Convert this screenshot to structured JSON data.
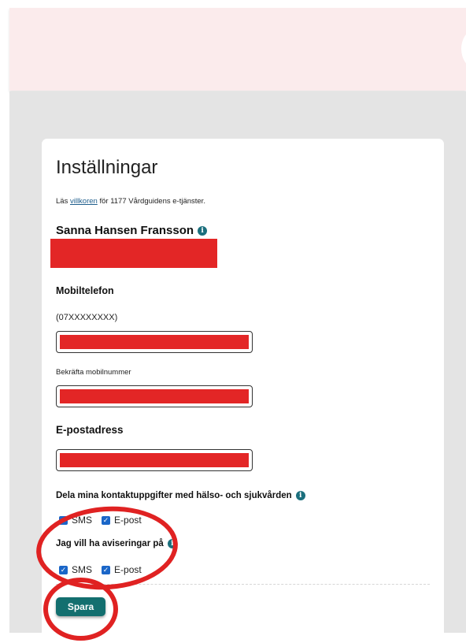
{
  "page": {
    "title": "Inställningar",
    "terms": {
      "prefix": "Läs ",
      "link": "villkoren",
      "suffix": " för 1177 Vårdguidens e-tjänster."
    },
    "user_name": "Sanna Hansen Fransson",
    "info_glyph": "i"
  },
  "form": {
    "mobile_label": "Mobiltelefon",
    "mobile_format_hint": "(07XXXXXXXX)",
    "confirm_mobile_label": "Bekräfta mobilnummer",
    "email_label": "E-postadress",
    "share_label": "Dela mina kontaktuppgifter med hälso- och sjukvården",
    "notify_label": "Jag vill ha aviseringar på",
    "sms_label": "SMS",
    "email_option_label": "E-post",
    "share_sms_checked": true,
    "share_email_checked": true,
    "notify_sms_checked": true,
    "notify_email_checked": true,
    "save_label": "Spara"
  },
  "colors": {
    "banner": "#fbebec",
    "page_background": "#e4e4e4",
    "accent": "#136f6f",
    "info_icon": "#1b6f7d",
    "checkbox": "#1a66c8",
    "redaction": "#e32626",
    "annotation": "#e02222"
  }
}
